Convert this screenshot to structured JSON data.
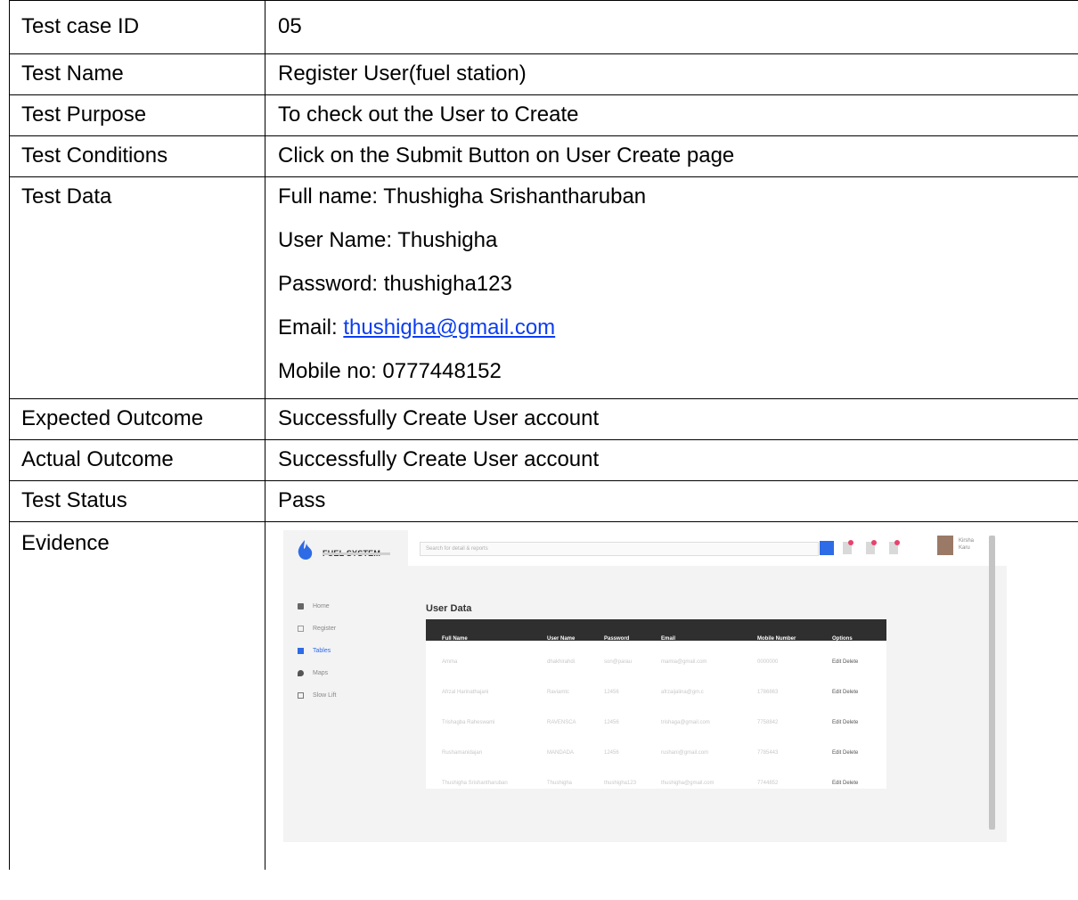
{
  "rows": {
    "id": {
      "label": "Test case ID",
      "value": "05"
    },
    "name": {
      "label": "Test Name",
      "value": "Register User(fuel station)"
    },
    "purpose": {
      "label": "Test Purpose",
      "value": "To check out the User to Create"
    },
    "conditions": {
      "label": "Test Conditions",
      "value": "Click on the Submit Button on User Create page"
    },
    "data": {
      "label": "Test Data",
      "full_name": "Full name: Thushigha Srishantharuban",
      "user_name": "User Name: Thushigha",
      "password": "Password: thushigha123",
      "email_prefix": "Email: ",
      "email_link": "thushigha@gmail.com",
      "mobile": "Mobile no: 0777448152"
    },
    "expected": {
      "label": "Expected Outcome",
      "value": "Successfully Create User account"
    },
    "actual": {
      "label": "Actual Outcome",
      "value": "Successfully Create User account"
    },
    "status": {
      "label": "Test Status",
      "value": "Pass"
    },
    "evidence": {
      "label": "Evidence"
    }
  },
  "screenshot": {
    "logo": "FUEL SYSTEM",
    "search_placeholder": "Search for detail & reports",
    "nav": [
      "Home",
      "Register",
      "Tables",
      "Maps",
      "Slow Lift"
    ],
    "user_name_line1": "Kirsha",
    "user_name_line2": "Karu",
    "page_title": "User Data",
    "columns": [
      "Full Name",
      "User Name",
      "Password",
      "Email",
      "Mobile Number",
      "Options"
    ],
    "table_rows": [
      [
        "Amma",
        "dhakhirahdi",
        "son@parau",
        "mamia@gmail.com",
        "0000000",
        "Edit Delete"
      ],
      [
        "Afrzal Harinathajani",
        "Raviamtc",
        "12456",
        "afrzaijalina@gm.c",
        "1786863",
        "Edit Delete"
      ],
      [
        "Trishagba Raheswami",
        "RAVENSCA",
        "12456",
        "trishaga@gmail.com",
        "7758842",
        "Edit Delete"
      ],
      [
        "Rushamanidajan",
        "MANDADA",
        "12456",
        "rushani@gmail.com",
        "7785443",
        "Edit Delete"
      ],
      [
        "Thushigha Srishantharuban",
        "Thushigha",
        "thushigha123",
        "thushigha@gmail.com",
        "7744852",
        "Edit Delete"
      ]
    ],
    "accent": "#2e6be6"
  }
}
